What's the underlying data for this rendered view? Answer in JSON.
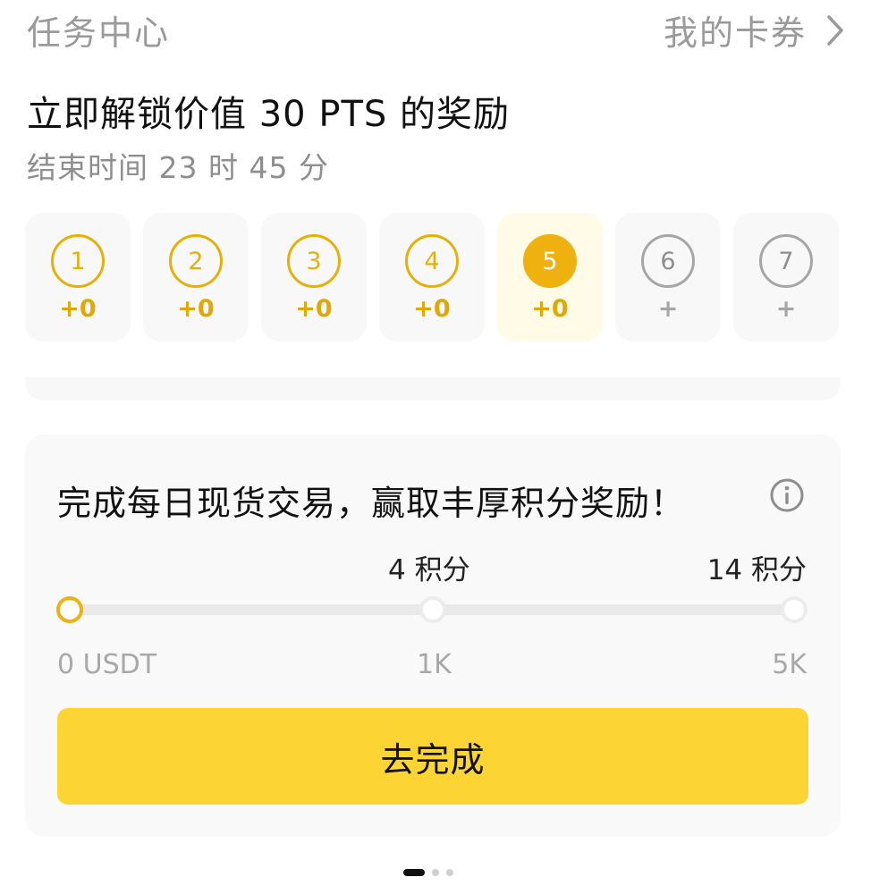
{
  "header": {
    "title": "任务中心",
    "link_label": "我的卡券",
    "link_icon": "chevron-right-icon"
  },
  "promo": {
    "headline": "立即解锁价值 30 PTS 的奖励",
    "countdown": "结束时间 23 时 45 分"
  },
  "checkin": {
    "days": [
      {
        "num": "1",
        "reward": "+0",
        "state": "claimed"
      },
      {
        "num": "2",
        "reward": "+0",
        "state": "claimed"
      },
      {
        "num": "3",
        "reward": "+0",
        "state": "claimed"
      },
      {
        "num": "4",
        "reward": "+0",
        "state": "claimed"
      },
      {
        "num": "5",
        "reward": "+0",
        "state": "current"
      },
      {
        "num": "6",
        "reward": "+",
        "state": "future"
      },
      {
        "num": "7",
        "reward": "+",
        "state": "future"
      }
    ]
  },
  "task": {
    "title": "完成每日现货交易，赢取丰厚积分奖励！",
    "info_icon": "info-icon",
    "milestones": [
      {
        "points": "",
        "threshold": "0 USDT",
        "reached": true
      },
      {
        "points": "4 积分",
        "threshold": "1K",
        "reached": false
      },
      {
        "points": "14 积分",
        "threshold": "5K",
        "reached": false
      }
    ],
    "progress_fraction": 0,
    "cta_label": "去完成"
  },
  "pager": {
    "pages": 3,
    "active_index": 0
  },
  "colors": {
    "accent": "#fcd535",
    "gold": "#efb110",
    "muted": "#9a9a9a"
  }
}
